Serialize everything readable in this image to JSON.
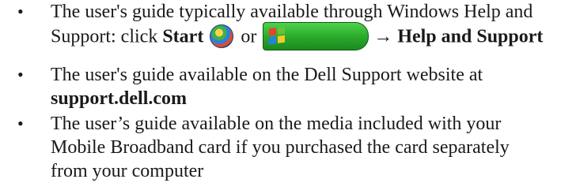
{
  "items": [
    {
      "lines": [
        "The user's guide typically available through Windows Help and",
        {
          "pre": "Support: click ",
          "start_label": "Start",
          "or_text": "or",
          "arrow": "→",
          "help_label": "Help and Support"
        }
      ],
      "icons": [
        "windows-vista-start-orb-icon",
        "windows-xp-start-button-icon"
      ]
    },
    {
      "lines": [
        "The user's guide available on the Dell Support website at",
        "support.dell.com"
      ]
    },
    {
      "lines": [
        "The user’s guide available on the media included with your",
        "Mobile Broadband card if you purchased the card separately",
        "from your computer"
      ]
    }
  ],
  "bullet": "•"
}
